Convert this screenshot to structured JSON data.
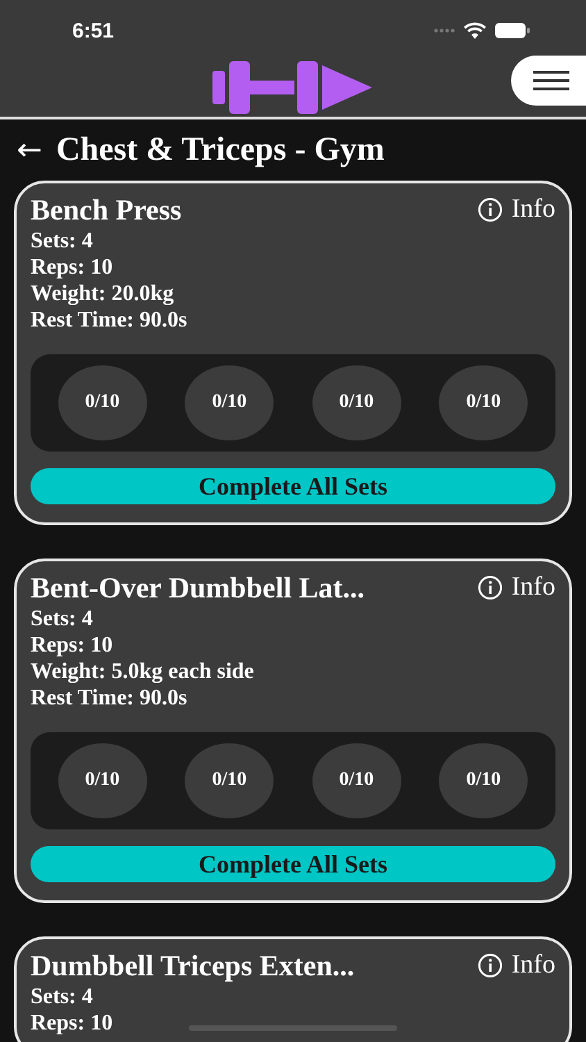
{
  "status_bar": {
    "time": "6:51"
  },
  "header": {
    "title": "Chest & Triceps - Gym",
    "back": "←"
  },
  "exercises": [
    {
      "name": "Bench Press",
      "info": "Info",
      "details": [
        "Sets: 4",
        "Reps: 10",
        "Weight: 20.0kg",
        "Rest Time: 90.0s"
      ],
      "sets": [
        "0/10",
        "0/10",
        "0/10",
        "0/10"
      ],
      "button": "Complete All Sets"
    },
    {
      "name": "Bent-Over Dumbbell Lat...",
      "info": "Info",
      "details": [
        "Sets: 4",
        "Reps: 10",
        "Weight: 5.0kg each side",
        "Rest Time: 90.0s"
      ],
      "sets": [
        "0/10",
        "0/10",
        "0/10",
        "0/10"
      ],
      "button": "Complete All Sets"
    },
    {
      "name": "Dumbbell Triceps Exten...",
      "info": "Info",
      "details": [
        "Sets: 4",
        "Reps: 10"
      ]
    }
  ]
}
